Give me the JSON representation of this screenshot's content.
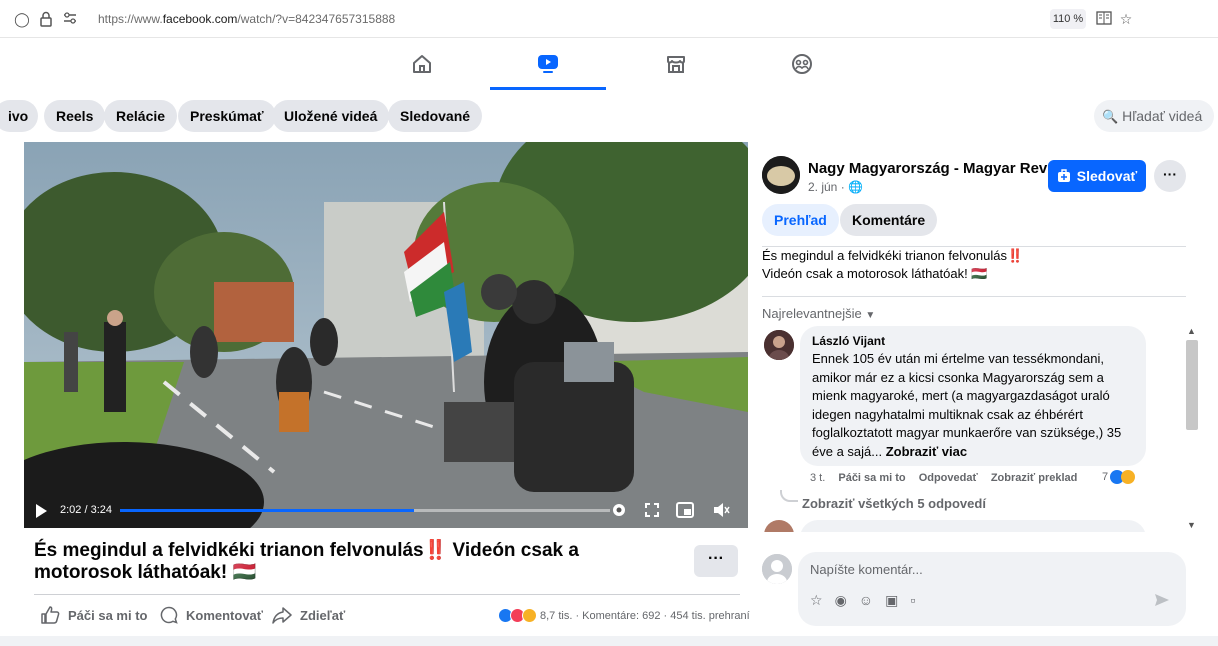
{
  "browser": {
    "url_prefix": "https://www.",
    "url_domain": "facebook.com",
    "url_path": "/watch/?v=842347657315888",
    "zoom": "110 %"
  },
  "nav": {
    "tabs": [
      {
        "icon": "home-icon",
        "active": false
      },
      {
        "icon": "watch-icon",
        "active": true
      },
      {
        "icon": "marketplace-icon",
        "active": false
      },
      {
        "icon": "groups-icon",
        "active": false
      }
    ]
  },
  "pills": {
    "items": [
      "ivo",
      "Reels",
      "Relácie",
      "Preskúmať",
      "Uložené videá",
      "Sledované"
    ],
    "search_placeholder": "Hľadať videá"
  },
  "video": {
    "time": "2:02 / 3:24",
    "progress": 0.6,
    "title": "És megindul a felvidkéki trianon felvonulás‼️ Videón csak a motorosok láthatóak! 🇭🇺"
  },
  "actions": {
    "like": "Páči sa mi to",
    "comment": "Komentovať",
    "share": "Zdieľať",
    "stats": "8,7 tis. · Komentáre: 692 · 454 tis. prehraní"
  },
  "page": {
    "name": "Nagy Magyarország - Magyar Revízió",
    "date": "2. jún ·",
    "follow": "Sledovať",
    "tab_overview": "Prehľad",
    "tab_comments": "Komentáre",
    "desc_line1": "És megindul a felvidkéki trianon felvonulás‼️",
    "desc_line2": "Videón csak a motorosok láthatóak! 🇭🇺",
    "sort": "Najrelevantnejšie"
  },
  "comments": [
    {
      "author": "László Vijant",
      "text": "Ennek 105 év után mi értelme van tessékmondani, amikor már ez a kicsi csonka Magyarország sem a mienk magyaroké, mert (a magyargazdaságot uraló idegen nagyhatalmi multiknak csak az éhbérért foglalkoztatott magyar munkaerőre van szüksége,) 35 éve a sajá...",
      "see_more": "Zobraziť viac",
      "age": "3 t.",
      "like": "Páči sa mi to",
      "reply": "Odpovedať",
      "translate": "Zobraziť preklad",
      "reactions": "7",
      "replies": "Zobraziť všetkých 5 odpovedí"
    }
  ],
  "composer": {
    "placeholder": "Napíšte komentár..."
  },
  "colors": {
    "accent": "#0866ff",
    "pill_bg": "#e4e6eb",
    "secondary_text": "#65676b"
  }
}
